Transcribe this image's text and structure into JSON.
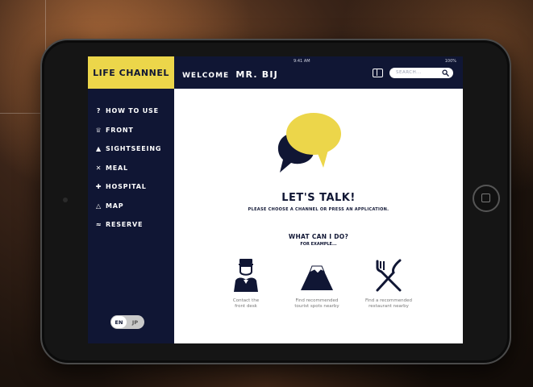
{
  "app": {
    "logo_text": "LIFE CHANNEL",
    "accent_color": "#ecd64a",
    "navy_color": "#101634"
  },
  "status_bar": {
    "time": "9:41 AM",
    "battery": "100%"
  },
  "header": {
    "welcome": "WELCOME",
    "user_name": "MR. BIJ"
  },
  "search": {
    "placeholder": "SEARCH..."
  },
  "sidebar": {
    "items": [
      {
        "label": "HOW TO USE",
        "icon": "help-icon"
      },
      {
        "label": "FRONT",
        "icon": "bell-icon"
      },
      {
        "label": "SIGHTSEEING",
        "icon": "mountain-icon"
      },
      {
        "label": "MEAL",
        "icon": "utensils-icon"
      },
      {
        "label": "HOSPITAL",
        "icon": "hospital-icon"
      },
      {
        "label": "MAP",
        "icon": "map-icon"
      },
      {
        "label": "RESERVE",
        "icon": "bed-icon"
      }
    ],
    "language": {
      "en": "EN",
      "jp": "JP",
      "selected": "EN"
    }
  },
  "main": {
    "title": "LET'S TALK!",
    "subtitle": "PLEASE CHOOSE A CHANNEL OR PRESS AN APPLICATION.",
    "question_title": "WHAT CAN I DO?",
    "question_sub": "FOR EXAMPLE...",
    "features": [
      {
        "label_line1": "Contact the",
        "label_line2": "front desk",
        "icon": "bellhop-icon"
      },
      {
        "label_line1": "Find recommended",
        "label_line2": "tourist spots nearby",
        "icon": "mount-fuji-icon"
      },
      {
        "label_line1": "Find a recommended",
        "label_line2": "restaurant nearby",
        "icon": "fork-knife-icon"
      }
    ]
  }
}
